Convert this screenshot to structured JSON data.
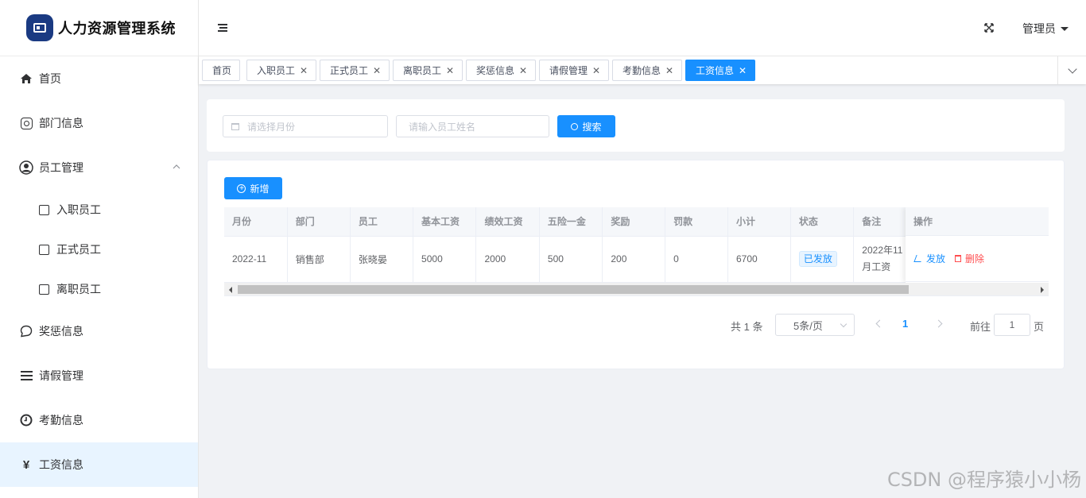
{
  "app": {
    "title": "人力资源管理系统"
  },
  "sidebar": {
    "items": [
      {
        "label": "首页",
        "icon": "home-icon"
      },
      {
        "label": "部门信息",
        "icon": "instagram-icon"
      },
      {
        "label": "员工管理",
        "icon": "user-circle-icon",
        "expanded": true,
        "children": [
          {
            "label": "入职员工",
            "icon": "square-icon"
          },
          {
            "label": "正式员工",
            "icon": "square-icon"
          },
          {
            "label": "离职员工",
            "icon": "square-icon"
          }
        ]
      },
      {
        "label": "奖惩信息",
        "icon": "chat-bubble-icon"
      },
      {
        "label": "请假管理",
        "icon": "list-icon"
      },
      {
        "label": "考勤信息",
        "icon": "clock-icon"
      },
      {
        "label": "工资信息",
        "icon": "yen-icon",
        "active": true
      }
    ]
  },
  "header": {
    "user": "管理员"
  },
  "tabs": [
    {
      "label": "首页",
      "closable": false
    },
    {
      "label": "入职员工",
      "closable": true
    },
    {
      "label": "正式员工",
      "closable": true
    },
    {
      "label": "离职员工",
      "closable": true
    },
    {
      "label": "奖惩信息",
      "closable": true
    },
    {
      "label": "请假管理",
      "closable": true
    },
    {
      "label": "考勤信息",
      "closable": true
    },
    {
      "label": "工资信息",
      "closable": true,
      "active": true
    }
  ],
  "search": {
    "month_placeholder": "请选择月份",
    "name_placeholder": "请输入员工姓名",
    "search_label": "搜索"
  },
  "toolbar": {
    "add_label": "新增"
  },
  "table": {
    "columns": [
      "月份",
      "部门",
      "员工",
      "基本工资",
      "绩效工资",
      "五险一金",
      "奖励",
      "罚款",
      "小计",
      "状态",
      "备注",
      "操作"
    ],
    "rows": [
      {
        "month": "2022-11",
        "department": "销售部",
        "employee": "张晓晏",
        "base_salary": "5000",
        "performance_salary": "2000",
        "insurance": "500",
        "reward": "200",
        "penalty": "0",
        "subtotal": "6700",
        "status": "已发放",
        "note": "2022年11月工资",
        "actions": {
          "pay": "发放",
          "delete": "删除"
        }
      }
    ]
  },
  "pagination": {
    "total_text": "共 1 条",
    "page_size": "5条/页",
    "current_page": "1",
    "goto_label": "前往",
    "goto_value": "1",
    "goto_suffix": "页"
  },
  "watermark": "CSDN @程序猿小小杨",
  "colors": {
    "primary": "#1890ff",
    "danger": "#ff4d4f",
    "logo": "#1a3a82"
  }
}
